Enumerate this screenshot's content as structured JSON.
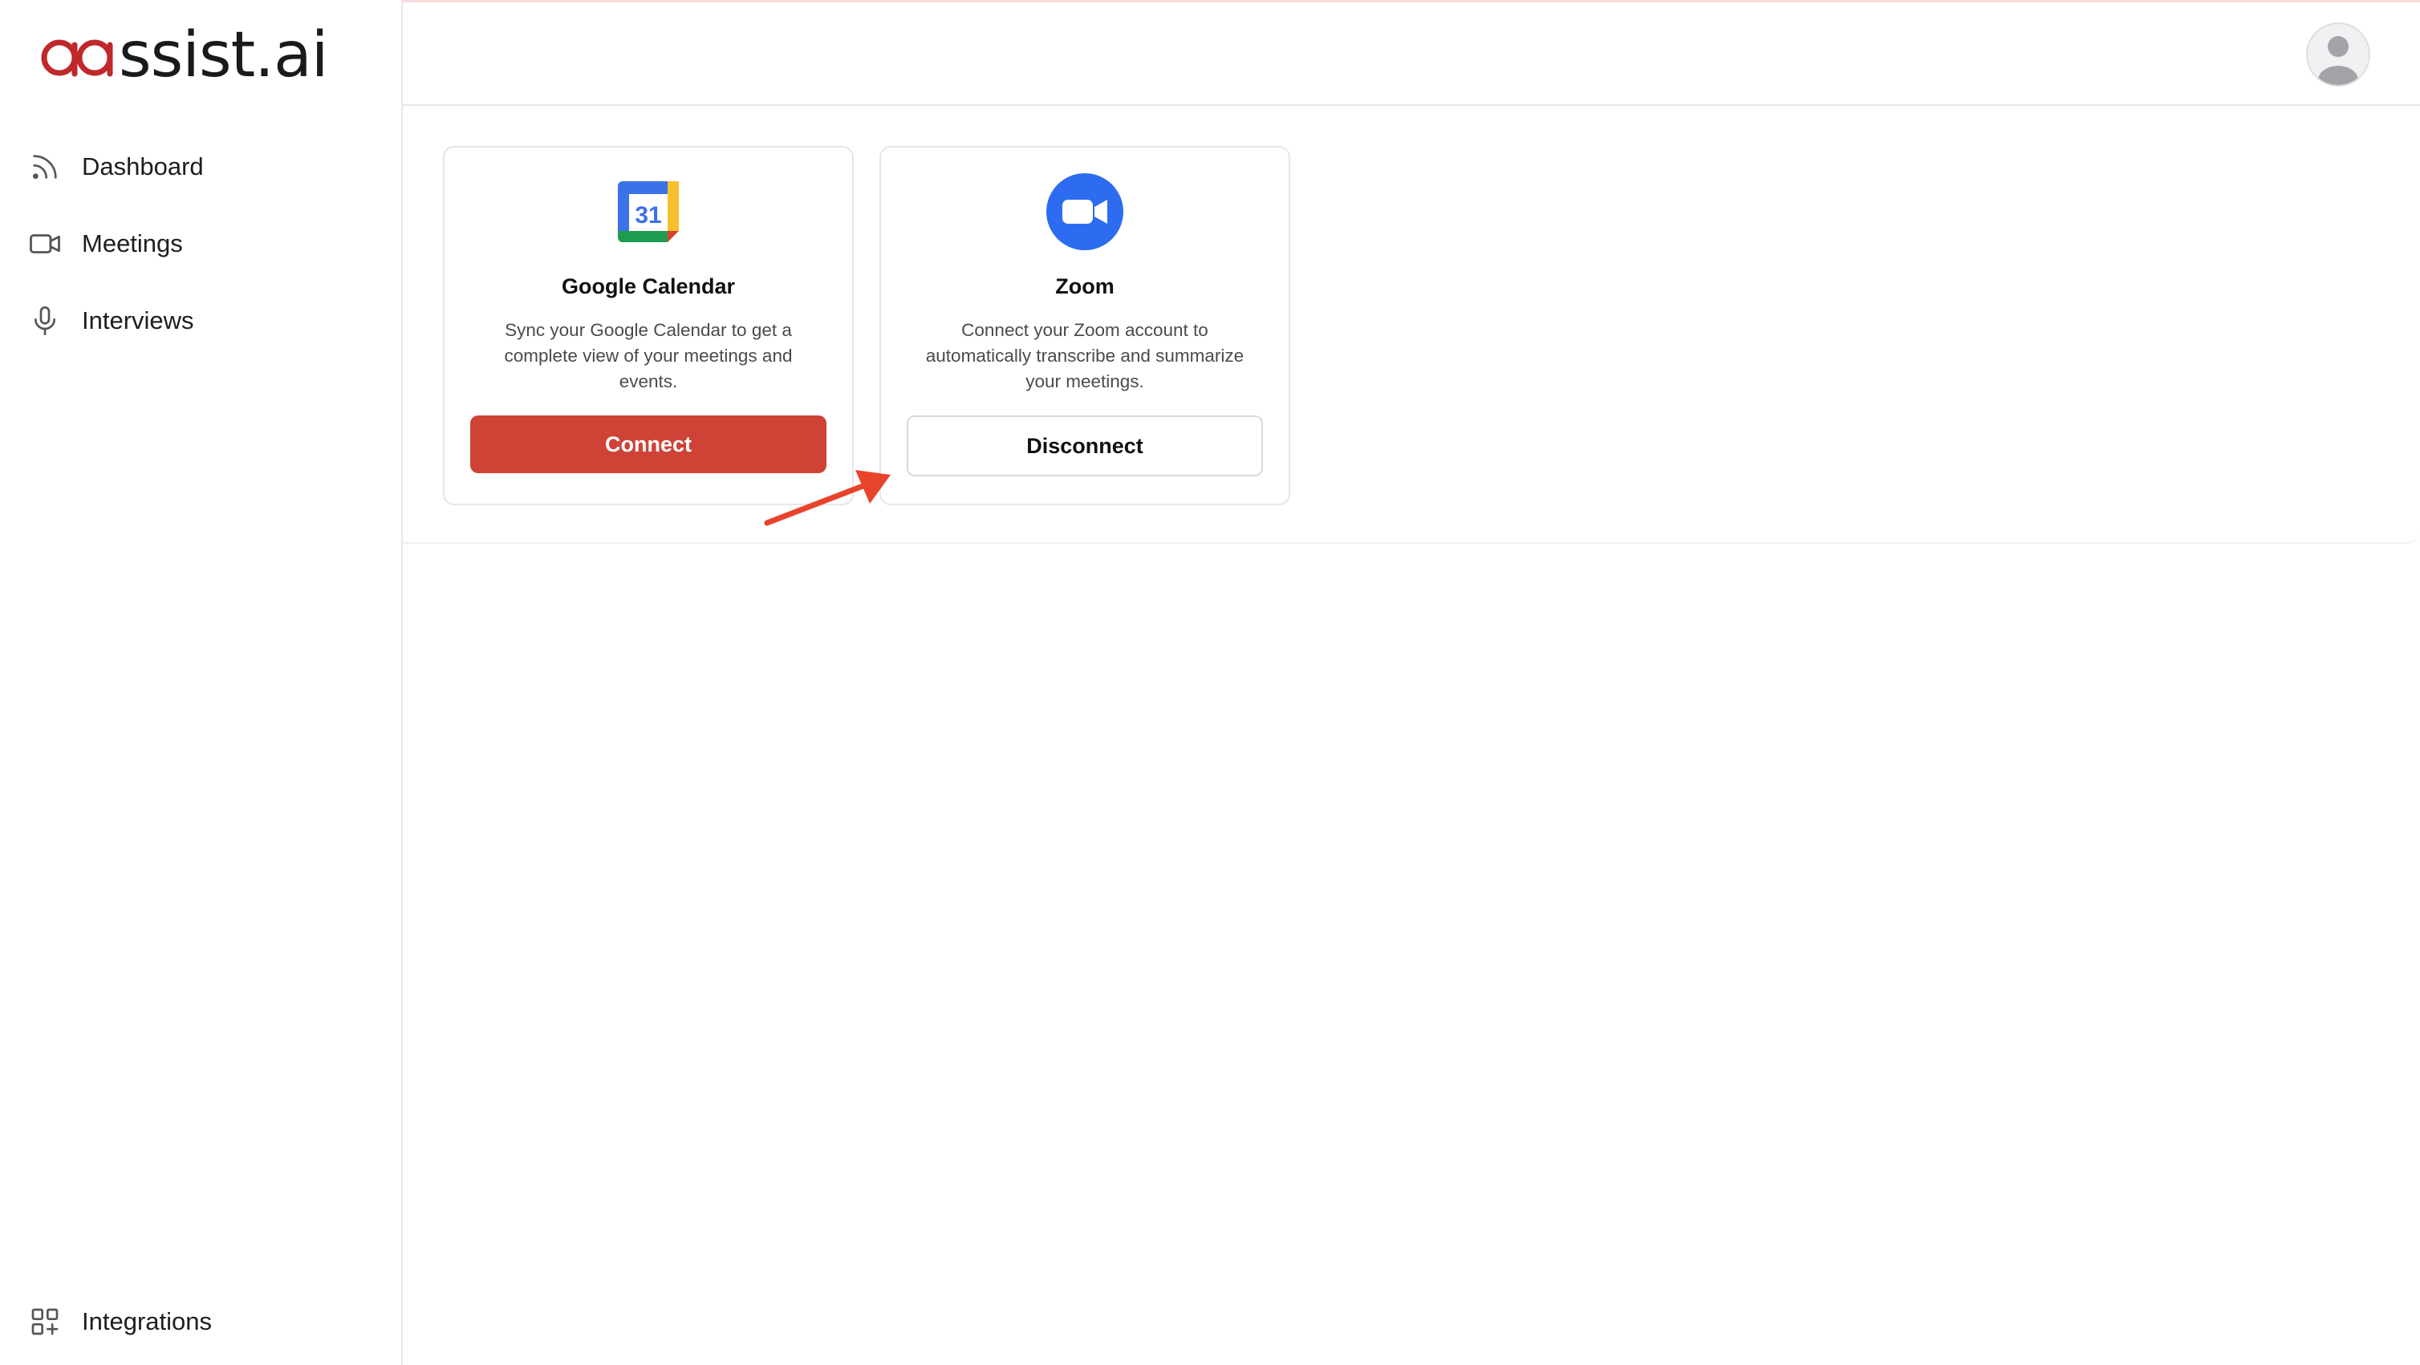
{
  "brand": {
    "name": "ssist.ai",
    "accent_color": "#c0282b"
  },
  "sidebar": {
    "items": [
      {
        "label": "Dashboard",
        "icon": "rss-feed-icon"
      },
      {
        "label": "Meetings",
        "icon": "video-camera-icon"
      },
      {
        "label": "Interviews",
        "icon": "microphone-icon"
      }
    ],
    "bottom_item": {
      "label": "Integrations",
      "icon": "grid-plus-icon"
    }
  },
  "header": {
    "avatar_icon": "user-avatar-icon"
  },
  "integrations": [
    {
      "name": "Google Calendar",
      "description": "Sync your Google Calendar to get a complete view of your meetings and events.",
      "calendar_day": "31",
      "button_label": "Connect",
      "button_color": "#cf4337",
      "icon": "google-calendar-icon"
    },
    {
      "name": "Zoom",
      "description": "Connect your Zoom account to automatically transcribe and summarize your meetings.",
      "button_label": "Disconnect",
      "icon_color": "#2d6cf0",
      "icon": "zoom-icon"
    }
  ],
  "annotation": {
    "arrow_color": "#e8432b",
    "icon": "red-arrow-annotation-icon"
  }
}
